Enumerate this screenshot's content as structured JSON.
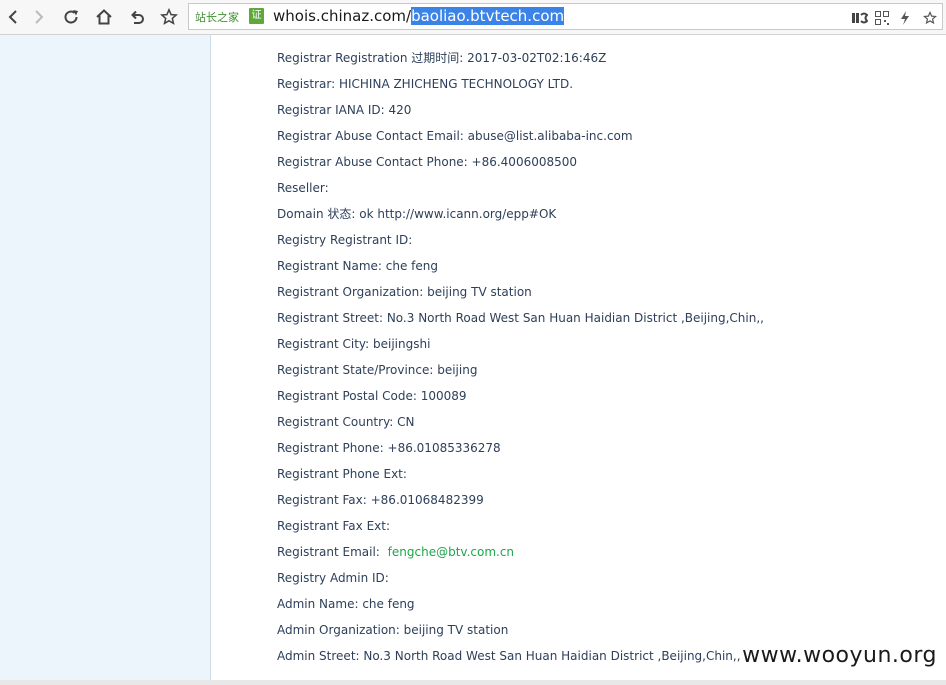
{
  "browser": {
    "site_label": "站长之家",
    "site_badge": "证",
    "url_host": "whois.chinaz.com/",
    "url_selected": "baoliao.btvtech.com"
  },
  "whois": {
    "rows": [
      "Registrar Registration 过期时间: 2017-03-02T02:16:46Z",
      "Registrar: HICHINA ZHICHENG TECHNOLOGY LTD.",
      "Registrar IANA ID: 420",
      "Registrar Abuse Contact Email: abuse@list.alibaba-inc.com",
      "Registrar Abuse Contact Phone: +86.4006008500",
      "Reseller:",
      "Domain 状态:  ok http://www.icann.org/epp#OK",
      "Registry Registrant ID:",
      "Registrant Name: che feng",
      "Registrant Organization: beijing TV station",
      "Registrant Street: No.3 North Road West San Huan Haidian District ,Beijing,Chin,,",
      "Registrant City: beijingshi",
      "Registrant State/Province: beijing",
      "Registrant Postal Code: 100089",
      "Registrant Country: CN",
      "Registrant Phone: +86.01085336278",
      "Registrant Phone Ext:",
      "Registrant Fax: +86.01068482399",
      "Registrant Fax Ext:"
    ],
    "email_label": "Registrant Email:",
    "email_value": "fengche@btv.com.cn",
    "rows_after": [
      "Registry Admin ID:",
      "Admin Name: che feng",
      "Admin Organization: beijing TV station",
      "Admin Street: No.3 North Road West San Huan Haidian District ,Beijing,Chin,,"
    ]
  },
  "watermark": "www.wooyun.org",
  "colors": {
    "selection": "#3b83e6",
    "email_link": "#1ea64a",
    "sidebar": "#edf5fc"
  }
}
